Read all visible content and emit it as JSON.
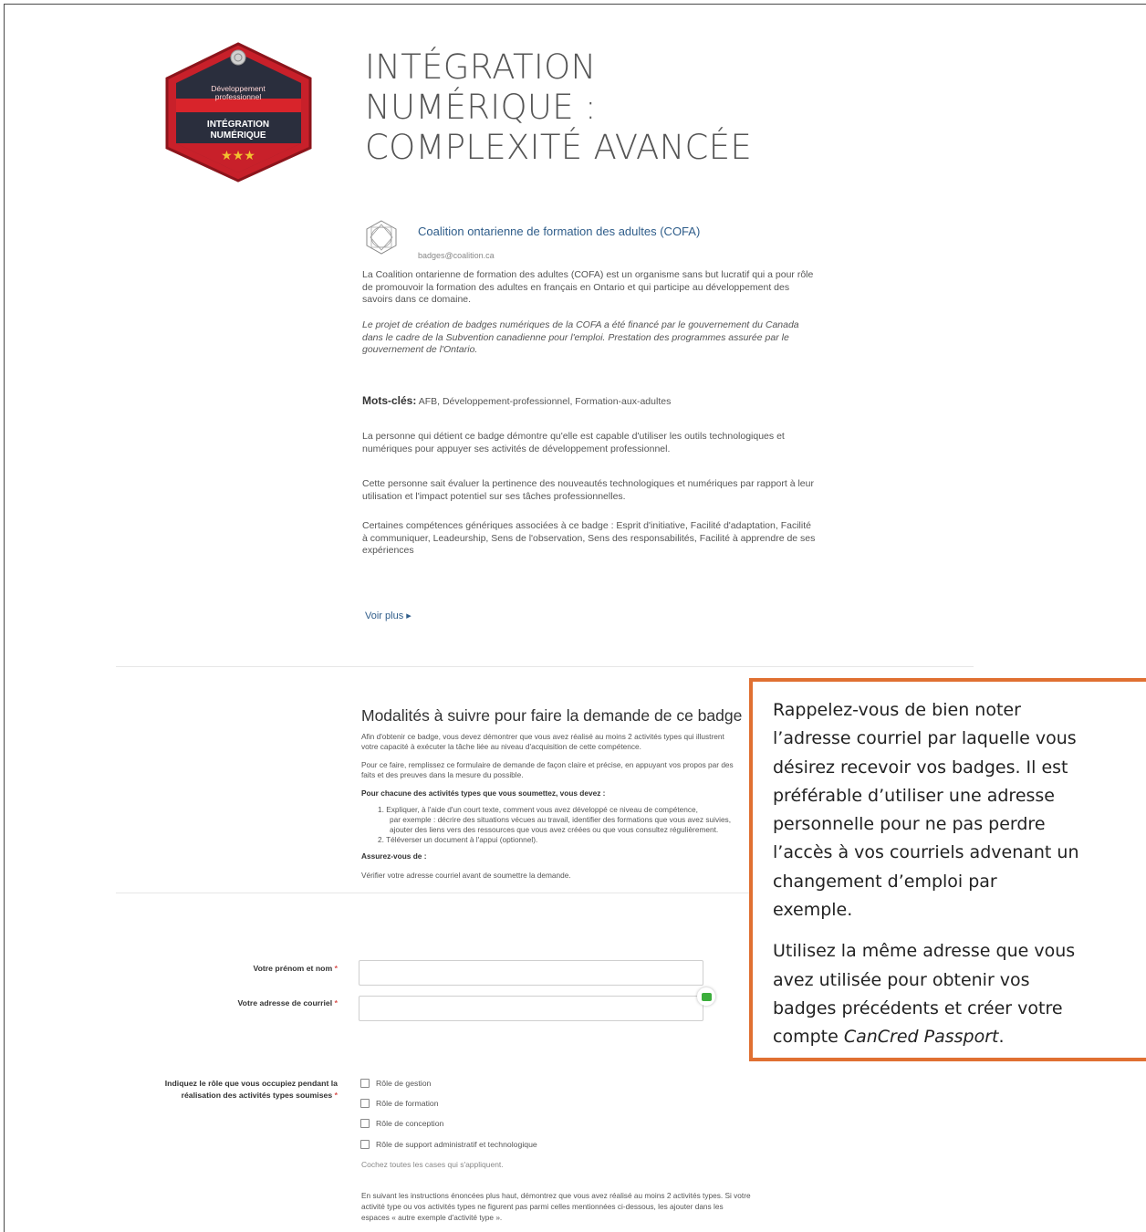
{
  "badge": {
    "top_text": "Développement professionnel",
    "main_text": "INTÉGRATION NUMÉRIQUE",
    "stars": "★★★",
    "colors": {
      "outer": "#c8202a",
      "inner": "#2a2e3d",
      "band": "#d8242b",
      "star": "#f2c230"
    }
  },
  "title_lines": [
    "INTÉGRATION",
    "NUMÉRIQUE :",
    "COMPLEXITÉ AVANCÉE"
  ],
  "issuer": {
    "name": "Coalition ontarienne de formation des adultes (COFA)",
    "email": "badges@coalition.ca"
  },
  "description": {
    "p1": "La Coalition ontarienne de formation des adultes (COFA) est un organisme sans but lucratif qui a pour rôle de promouvoir la formation des adultes en français en Ontario et qui participe au développement des savoirs dans ce domaine.",
    "p2": "Le projet de création de badges numériques de la COFA a été financé par le gouvernement du Canada dans le cadre de la Subvention canadienne pour l'emploi. Prestation des programmes assurée par le gouvernement de l'Ontario.",
    "keywords_label": "Mots-clés:",
    "keywords": "AFB, Développement-professionnel, Formation-aux-adultes",
    "p3": "La personne qui détient ce badge démontre qu'elle est capable d'utiliser les outils technologiques et numériques pour appuyer ses activités de développement professionnel.",
    "p4": "Cette personne sait évaluer la pertinence des nouveautés technologiques et numériques par rapport à leur utilisation et l'impact potentiel sur ses tâches professionnelles.",
    "p5": "Certaines compétences génériques associées à ce badge : Esprit d'initiative, Facilité d'adaptation, Facilité à communiquer, Leadeurship, Sens de l'observation, Sens des responsabilités, Facilité à apprendre de ses expériences",
    "voir_plus": "Voir plus ▸"
  },
  "modalites": {
    "title": "Modalités à suivre pour faire la demande de ce badge",
    "l1": "Afin d'obtenir ce badge, vous devez démontrer que vous avez réalisé au moins 2 activités types qui illustrent",
    "l2": "votre capacité à exécuter la tâche liée au niveau d'acquisition de cette compétence.",
    "l3": "Pour ce faire, remplissez ce formulaire de demande de façon claire et précise, en appuyant vos propos par des",
    "l4": "faits et des preuves dans la mesure du possible.",
    "bold1": "Pour chacune des activités types que vous soumettez, vous devez :",
    "li1a": "1. Expliquer, à l'aide d'un court texte, comment vous avez développé ce niveau de compétence,",
    "li1b": "par exemple : décrire des situations vécues au travail, identifier des formations que vous avez suivies,",
    "li1c": "ajouter des liens vers des ressources que vous avez créées ou que vous consultez régulièrement.",
    "li2": "2. Téléverser un document à l'appui (optionnel).",
    "bold2": "Assurez-vous de :",
    "l5": "Vérifier votre adresse courriel avant de soumettre la demande."
  },
  "form": {
    "name_label": "Votre prénom et nom",
    "email_label": "Votre adresse de courriel",
    "required_mark": "*",
    "role_label_1": "Indiquez le rôle que vous occupiez pendant la",
    "role_label_2": "réalisation des activités types soumises",
    "roles": [
      "Rôle de gestion",
      "Rôle de formation",
      "Rôle de conception",
      "Rôle de support administratif et technologique"
    ],
    "roles_hint": "Cochez toutes les cases qui s'appliquent.",
    "bottom_1": "En suivant les instructions énoncées plus haut, démontrez que vous avez réalisé au moins 2 activités types. Si votre",
    "bottom_2": "activité type ou vos activités types ne figurent pas parmi celles mentionnées ci-dessous, les ajouter dans les",
    "bottom_3": "espaces « autre exemple d'activité type »."
  },
  "callout": {
    "border_color": "#e07032",
    "lines_1": [
      "Rappelez-vous de bien noter",
      "l’adresse courriel par laquelle vous",
      "désirez recevoir vos badges. Il est",
      "préférable d’utiliser une adresse",
      "personnelle pour ne pas perdre",
      "l’accès à vos courriels advenant un",
      "changement d’emploi par",
      "exemple."
    ],
    "lines_2a": [
      "Utilisez la même adresse que vous",
      "avez utilisée pour obtenir vos",
      "badges précédents et créer votre"
    ],
    "line_last_prefix": "compte ",
    "line_last_italic": "CanCred Passport",
    "line_last_suffix": "."
  }
}
